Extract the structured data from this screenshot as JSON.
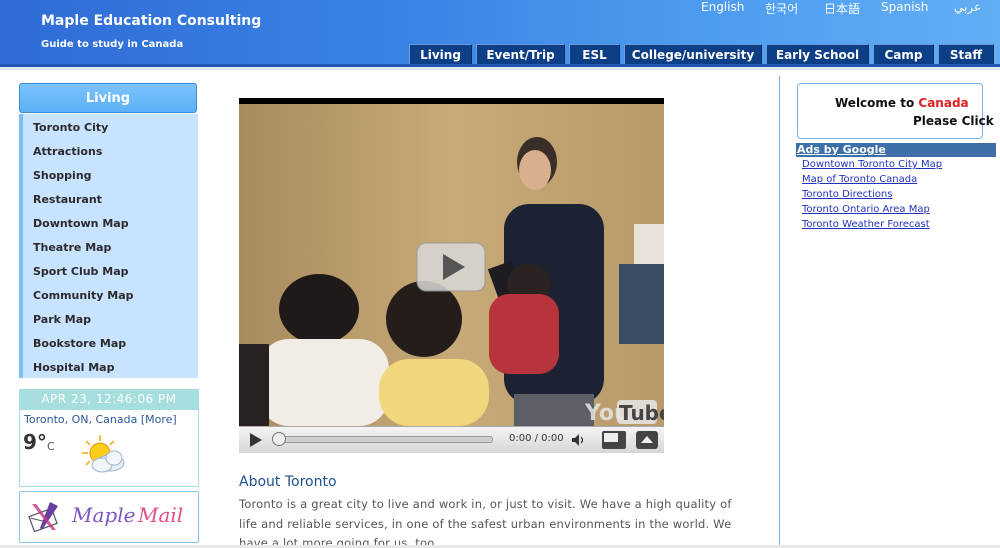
{
  "header": {
    "title": "Maple Education Consulting",
    "subtitle": "Guide to study in Canada",
    "languages": [
      "English",
      "한국어",
      "日本語",
      "Spanish",
      "عربي"
    ]
  },
  "nav": {
    "tabs": [
      "Living",
      "Event/Trip",
      "ESL",
      "College/university",
      "Early School",
      "Camp",
      "Staff"
    ]
  },
  "sidebar": {
    "heading": "Living",
    "items": [
      "Toronto City",
      "Attractions",
      "Shopping",
      "Restaurant",
      "Downtown Map",
      "Theatre Map",
      "Sport Club Map",
      "Community Map",
      "Park Map",
      "Bookstore Map",
      "Hospital Map"
    ]
  },
  "clock": {
    "text": "APR 23,  12:46:06 PM"
  },
  "weather": {
    "location": "Toronto, ON, Canada [More]",
    "temp": "9°",
    "unit": "C",
    "icon": "sun-cloud-icon"
  },
  "mail": {
    "word1": "Maple",
    "word2": "Mail"
  },
  "video": {
    "time": "0:00 / 0:00",
    "watermark": "YouTube",
    "progress": 0
  },
  "about": {
    "title": "About Toronto",
    "text": "Toronto is a great city to live and work in, or just to visit. We have a high quality of life and reliable services, in one of the safest urban environments in the world. We have a lot more going for us, too."
  },
  "welcome": {
    "prefix": "Welcome to ",
    "highlight": "Canada",
    "line2": "Please Click"
  },
  "ads": {
    "heading": "Ads by Google",
    "links": [
      "Downtown Toronto City Map",
      "Map of Toronto Canada",
      "Toronto Directions",
      "Toronto Ontario Area Map",
      "Toronto Weather Forecast"
    ]
  },
  "colors": {
    "header_blue": "#3a84e4",
    "nav_tab": "#0d3f87",
    "sidebar_bg": "#c7e3ff",
    "clock_bg": "#a6dedd",
    "accent_red": "#e02020",
    "link_blue": "#2233bb"
  }
}
